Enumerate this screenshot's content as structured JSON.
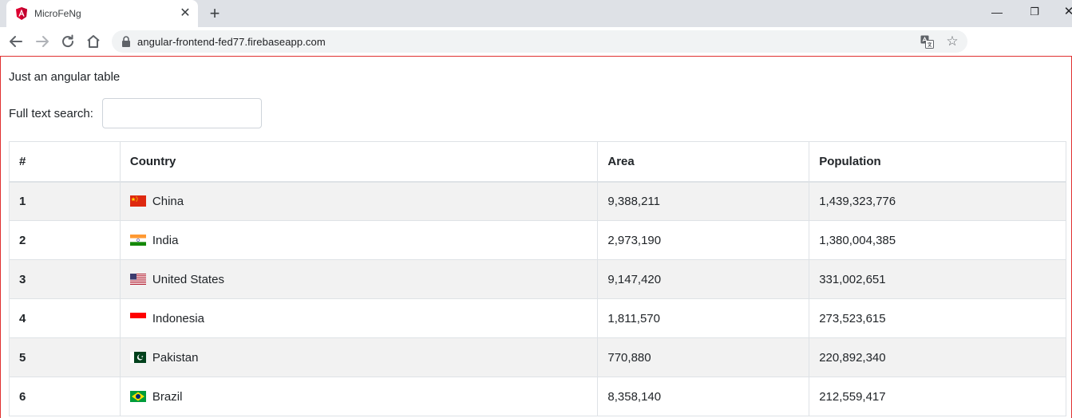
{
  "browser": {
    "tab_title": "MicroFeNg",
    "url": "angular-frontend-fed77.firebaseapp.com"
  },
  "page": {
    "title": "Just an angular table",
    "search": {
      "label": "Full text search:",
      "value": "",
      "placeholder": ""
    }
  },
  "table": {
    "headers": [
      "#",
      "Country",
      "Area",
      "Population"
    ],
    "rows": [
      {
        "index": "1",
        "country": "China",
        "flag": "china-flag-icon",
        "area": "9,388,211",
        "population": "1,439,323,776"
      },
      {
        "index": "2",
        "country": "India",
        "flag": "india-flag-icon",
        "area": "2,973,190",
        "population": "1,380,004,385"
      },
      {
        "index": "3",
        "country": "United States",
        "flag": "united-states-flag-icon",
        "area": "9,147,420",
        "population": "331,002,651"
      },
      {
        "index": "4",
        "country": "Indonesia",
        "flag": "indonesia-flag-icon",
        "area": "1,811,570",
        "population": "273,523,615"
      },
      {
        "index": "5",
        "country": "Pakistan",
        "flag": "pakistan-flag-icon",
        "area": "770,880",
        "population": "220,892,340"
      },
      {
        "index": "6",
        "country": "Brazil",
        "flag": "brazil-flag-icon",
        "area": "8,358,140",
        "population": "212,559,417"
      }
    ]
  },
  "colors": {
    "frame_border": "#e03131",
    "striped_row": "#f2f2f2",
    "angular_red": "#dd0031"
  }
}
